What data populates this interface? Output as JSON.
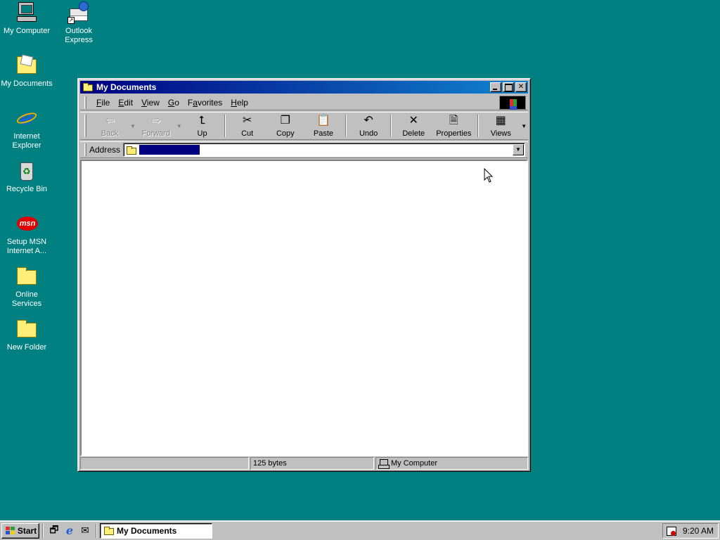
{
  "desktop": {
    "icons": [
      {
        "label": "My Computer",
        "icon": "my-computer-icon"
      },
      {
        "label": "Outlook\nExpress",
        "icon": "outlook-express-icon"
      },
      {
        "label": "My Documents",
        "icon": "my-documents-icon"
      },
      {
        "label": "Internet\nExplorer",
        "icon": "internet-explorer-icon"
      },
      {
        "label": "Recycle Bin",
        "icon": "recycle-bin-icon"
      },
      {
        "label": "Setup MSN\nInternet A...",
        "icon": "msn-icon"
      },
      {
        "label": "Online\nServices",
        "icon": "folder-icon"
      },
      {
        "label": "New Folder",
        "icon": "folder-icon"
      }
    ],
    "background_color": "#008080"
  },
  "window": {
    "title": "My Documents",
    "menu": [
      {
        "accel": "F",
        "rest": "ile"
      },
      {
        "accel": "E",
        "rest": "dit"
      },
      {
        "accel": "V",
        "rest": "iew"
      },
      {
        "accel": "G",
        "rest": "o"
      },
      {
        "pre": "F",
        "accel": "a",
        "rest": "vorites"
      },
      {
        "accel": "H",
        "rest": "elp"
      }
    ],
    "toolbar": {
      "back": "Back",
      "forward": "Forward",
      "up": "Up",
      "cut": "Cut",
      "copy": "Copy",
      "paste": "Paste",
      "undo": "Undo",
      "delete": "Delete",
      "properties": "Properties",
      "views": "Views"
    },
    "address": {
      "label": "Address",
      "value": ""
    },
    "status": {
      "panel1": "",
      "panel2": "125 bytes",
      "panel3": "My Computer"
    }
  },
  "taskbar": {
    "start": "Start",
    "task": "My Documents",
    "clock": "9:20 AM"
  }
}
